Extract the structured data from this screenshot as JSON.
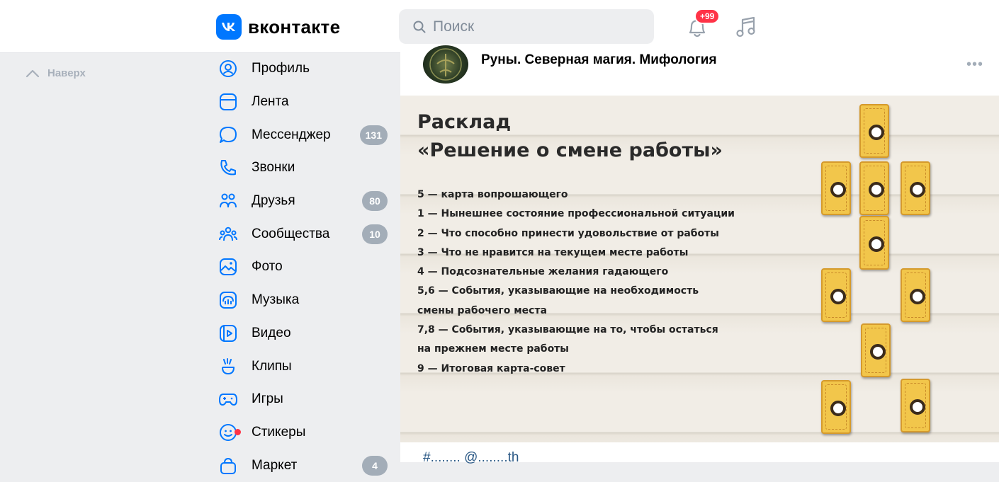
{
  "header": {
    "logo_mark": "ᴠᴋ",
    "logo_text": "вконтакте",
    "search_placeholder": "Поиск",
    "notifications_badge": "+99"
  },
  "to_top_label": "Наверх",
  "menu": [
    {
      "label": "Профиль",
      "icon": "profile-icon",
      "count": ""
    },
    {
      "label": "Лента",
      "icon": "feed-icon",
      "count": ""
    },
    {
      "label": "Мессенджер",
      "icon": "messenger-icon",
      "count": "131"
    },
    {
      "label": "Звонки",
      "icon": "phone-icon",
      "count": ""
    },
    {
      "label": "Друзья",
      "icon": "friends-icon",
      "count": "80"
    },
    {
      "label": "Сообщества",
      "icon": "communities-icon",
      "count": "10"
    },
    {
      "label": "Фото",
      "icon": "photo-icon",
      "count": ""
    },
    {
      "label": "Музыка",
      "icon": "music-icon",
      "count": ""
    },
    {
      "label": "Видео",
      "icon": "video-icon",
      "count": ""
    },
    {
      "label": "Клипы",
      "icon": "clips-icon",
      "count": ""
    },
    {
      "label": "Игры",
      "icon": "games-icon",
      "count": ""
    },
    {
      "label": "Стикеры",
      "icon": "stickers-icon",
      "count": ""
    },
    {
      "label": "Маркет",
      "icon": "market-icon",
      "count": "4"
    }
  ],
  "post": {
    "author": "Руны. Северная магия. Мифология",
    "image_title_1": "Расклад",
    "image_title_2": "«Решение о смене работы»",
    "legend": [
      "5 — карта вопрошающего",
      "1 — Нынешнее состояние профессиональной ситуации",
      "2 — Что способно принести удовольствие от работы",
      "3 — Что не нравится на текущем месте работы",
      "4 — Подсознательные желания гадающего",
      "5,6 — События, указывающие на необходимость",
      "смены рабочего места",
      "7,8 — События, указывающие на то, чтобы остаться",
      "на прежнем месте работы",
      "9 — Итоговая карта-совет"
    ],
    "footer_text": "#........ @........th"
  },
  "colors": {
    "accent": "#0077ff",
    "badge": "#ff3347",
    "counter": "#a3adb8"
  }
}
